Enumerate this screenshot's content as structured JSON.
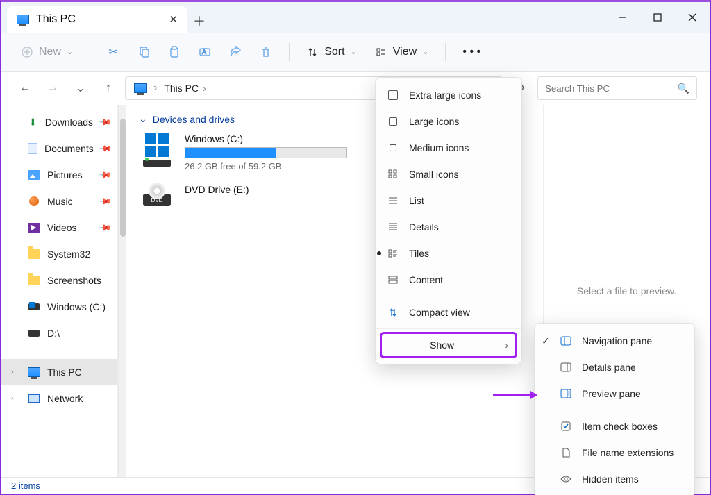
{
  "titlebar": {
    "tab_title": "This PC"
  },
  "toolbar": {
    "new": "New",
    "sort": "Sort",
    "view": "View"
  },
  "breadcrumb": {
    "root": "This PC"
  },
  "search": {
    "placeholder": "Search This PC"
  },
  "sidebar": {
    "items": [
      {
        "label": "Downloads",
        "pinned": true
      },
      {
        "label": "Documents",
        "pinned": true
      },
      {
        "label": "Pictures",
        "pinned": true
      },
      {
        "label": "Music",
        "pinned": true
      },
      {
        "label": "Videos",
        "pinned": true
      },
      {
        "label": "System32",
        "pinned": false
      },
      {
        "label": "Screenshots",
        "pinned": false
      },
      {
        "label": "Windows (C:)",
        "pinned": false
      },
      {
        "label": "D:\\",
        "pinned": false
      }
    ],
    "this_pc": "This PC",
    "network": "Network"
  },
  "content": {
    "section": "Devices and drives",
    "drives": [
      {
        "name": "Windows (C:)",
        "sub": "26.2 GB free of 59.2 GB",
        "fill_pct": 56
      },
      {
        "name": "DVD Drive (E:)",
        "sub": "",
        "fill_pct": null
      }
    ]
  },
  "preview": {
    "hint": "Select a file to preview."
  },
  "status": {
    "text": "2 items"
  },
  "view_menu": {
    "items": [
      "Extra large icons",
      "Large icons",
      "Medium icons",
      "Small icons",
      "List",
      "Details",
      "Tiles",
      "Content"
    ],
    "compact": "Compact view",
    "show": "Show"
  },
  "show_menu": {
    "items": [
      {
        "label": "Navigation pane",
        "checked": true
      },
      {
        "label": "Details pane",
        "checked": false
      },
      {
        "label": "Preview pane",
        "checked": false
      },
      {
        "label": "Item check boxes",
        "checked": false
      },
      {
        "label": "File name extensions",
        "checked": false
      },
      {
        "label": "Hidden items",
        "checked": false
      }
    ]
  }
}
